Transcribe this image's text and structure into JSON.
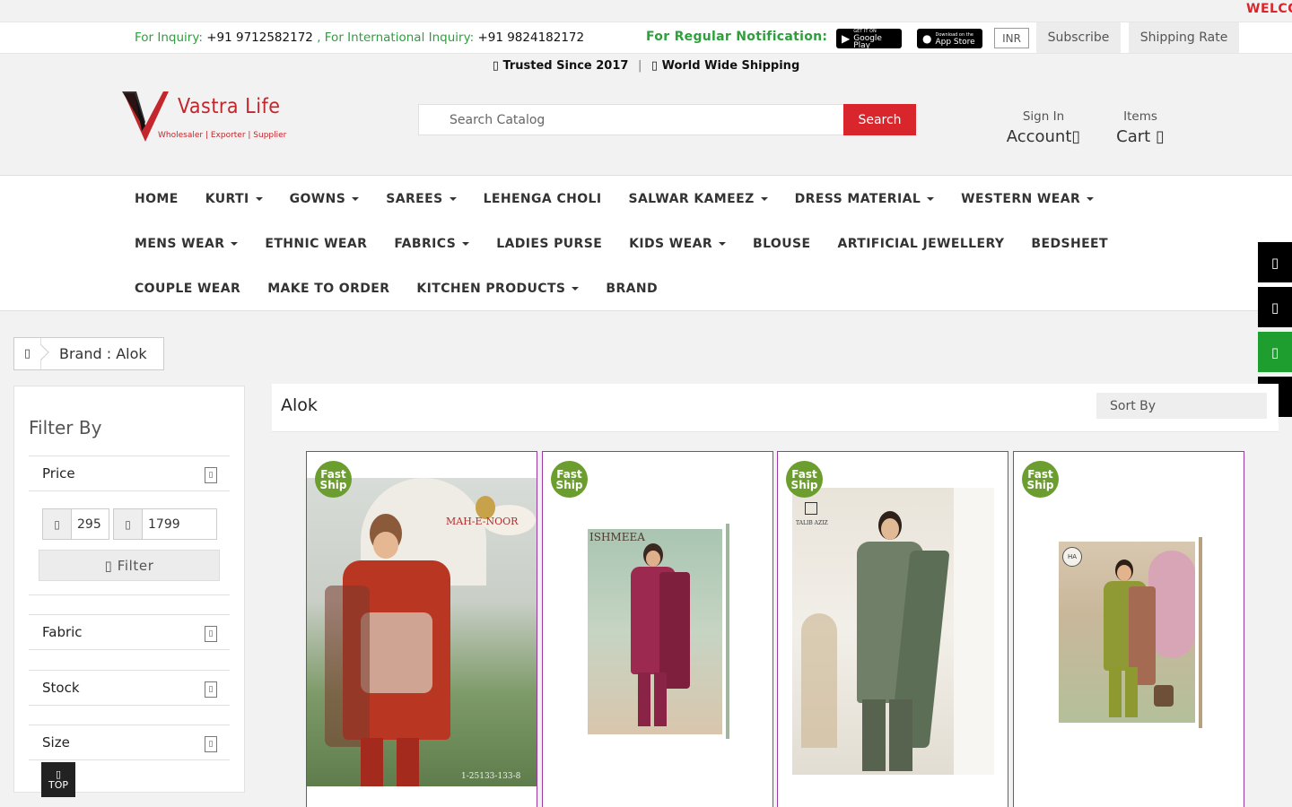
{
  "marquee": {
    "text": "WELCO"
  },
  "topbar": {
    "inquiry_label": "For Inquiry:",
    "inquiry_number": "+91 9712582172",
    "intl_label": ", For International Inquiry:",
    "intl_number": "+91 9824182172",
    "notify_label": "For Regular Notification:",
    "google_play": {
      "line1": "GET IT ON",
      "line2": "Google Play"
    },
    "app_store": {
      "line1": "Download on the",
      "line2": "App Store"
    },
    "currency": "INR",
    "subscribe": "Subscribe",
    "shipping_rate": "Shipping Rate"
  },
  "header": {
    "trusted": "Trusted Since 2017",
    "separator": "|",
    "shipping": "World Wide Shipping",
    "logo_name": "Vastra Life",
    "logo_tagline": "Wholesaler | Exporter | Supplier",
    "search_placeholder": "Search Catalog",
    "search_button": "Search",
    "sign_in_small": "Sign In",
    "account": "Account",
    "items_small": "Items",
    "cart": "Cart"
  },
  "nav": {
    "row1": [
      {
        "label": "HOME",
        "dropdown": false
      },
      {
        "label": "KURTI",
        "dropdown": true
      },
      {
        "label": "GOWNS",
        "dropdown": true
      },
      {
        "label": "SAREES",
        "dropdown": true
      },
      {
        "label": "LEHENGA CHOLI",
        "dropdown": false
      },
      {
        "label": "SALWAR KAMEEZ",
        "dropdown": true
      },
      {
        "label": "DRESS MATERIAL",
        "dropdown": true
      },
      {
        "label": "WESTERN WEAR",
        "dropdown": true
      }
    ],
    "row2": [
      {
        "label": "MENS WEAR",
        "dropdown": true
      },
      {
        "label": "ETHNIC WEAR",
        "dropdown": false
      },
      {
        "label": "FABRICS",
        "dropdown": true
      },
      {
        "label": "LADIES PURSE",
        "dropdown": false
      },
      {
        "label": "KIDS WEAR",
        "dropdown": true
      },
      {
        "label": "BLOUSE",
        "dropdown": false
      },
      {
        "label": "ARTIFICIAL JEWELLERY",
        "dropdown": false
      },
      {
        "label": "BEDSHEET",
        "dropdown": false
      }
    ],
    "row3": [
      {
        "label": "COUPLE WEAR",
        "dropdown": false
      },
      {
        "label": "MAKE TO ORDER",
        "dropdown": false
      },
      {
        "label": "KITCHEN PRODUCTS",
        "dropdown": true
      },
      {
        "label": "BRAND",
        "dropdown": false
      }
    ]
  },
  "breadcrumb": {
    "text": "Brand : Alok"
  },
  "filter": {
    "title": "Filter By",
    "price_label": "Price",
    "min": "295",
    "max": "1799",
    "filter_button": "Filter",
    "fabric_label": "Fabric",
    "stock_label": "Stock",
    "size_label": "Size"
  },
  "listing": {
    "title": "Alok",
    "sort_by": "Sort By"
  },
  "products": [
    {
      "badge_line1": "Fast",
      "badge_line2": "Ship",
      "brand_text": "MAH-E-NOOR",
      "code": "1-25133-133-8"
    },
    {
      "badge_line1": "Fast",
      "badge_line2": "Ship",
      "brand_text": "ISHMEEA"
    },
    {
      "badge_line1": "Fast",
      "badge_line2": "Ship",
      "brand_text": "TALIB AZIZ"
    },
    {
      "badge_line1": "Fast",
      "badge_line2": "Ship",
      "brand_text": "HA"
    }
  ],
  "top_button": "TOP",
  "colors": {
    "brand_red": "#d9262c",
    "green": "#2e9f3c",
    "badge_green": "#6c9d2f",
    "card_border": "#9c37a6",
    "whatsapp_green": "#1d9e2e"
  },
  "icons": {
    "store_badges": [
      "google-play-icon",
      "apple-icon"
    ],
    "header": [
      "search-icon",
      "user-icon",
      "cart-icon",
      "shield-icon",
      "globe-icon"
    ],
    "social": [
      "facebook-icon",
      "instagram-icon",
      "whatsapp-icon",
      "telegram-icon"
    ],
    "breadcrumb": "home-icon",
    "filter": [
      "plus-icon",
      "rupee-icon",
      "filter-icon"
    ],
    "top": "arrow-up-icon"
  }
}
